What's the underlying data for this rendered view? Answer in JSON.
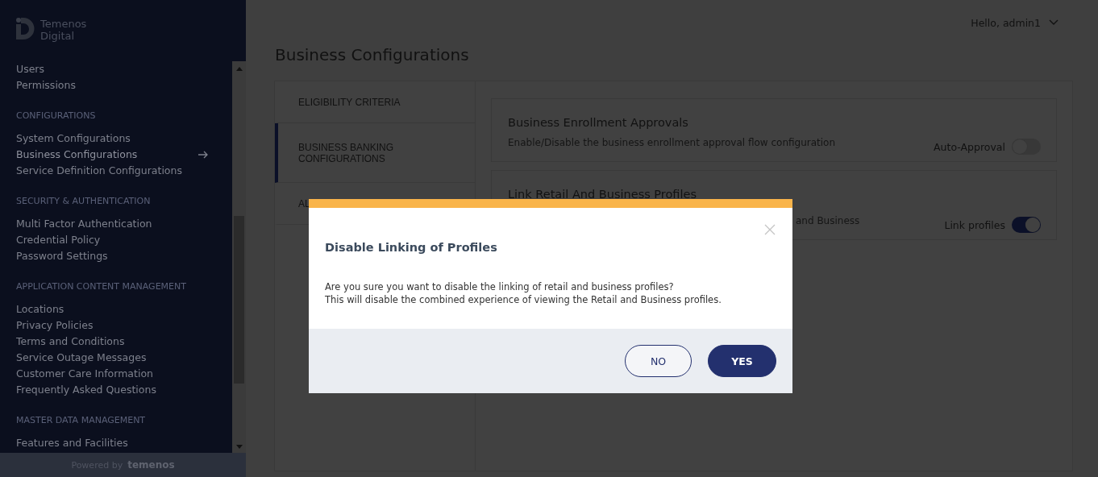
{
  "sidebar": {
    "logo": {
      "line_1": "Temenos",
      "line_2": "Digital"
    },
    "groups": [
      {
        "items": [
          {
            "label": "Users",
            "selected": false
          },
          {
            "label": "Permissions",
            "selected": false
          }
        ]
      },
      {
        "heading": "CONFIGURATIONS",
        "items": [
          {
            "label": "System Configurations",
            "selected": false
          },
          {
            "label": "Business Configurations",
            "selected": true
          },
          {
            "label": "Service Definition Configurations",
            "selected": false
          }
        ]
      },
      {
        "heading": "SECURITY & AUTHENTICATION",
        "items": [
          {
            "label": "Multi Factor Authentication",
            "selected": false
          },
          {
            "label": "Credential Policy",
            "selected": false
          },
          {
            "label": "Password Settings",
            "selected": false
          }
        ]
      },
      {
        "heading": "APPLICATION CONTENT MANAGEMENT",
        "items": [
          {
            "label": "Locations",
            "selected": false
          },
          {
            "label": "Privacy Policies",
            "selected": false
          },
          {
            "label": "Terms and Conditions",
            "selected": false
          },
          {
            "label": "Service Outage Messages",
            "selected": false
          },
          {
            "label": "Customer Care Information",
            "selected": false
          },
          {
            "label": "Frequently Asked Questions",
            "selected": false
          }
        ]
      },
      {
        "heading": "MASTER DATA MANAGEMENT",
        "items": [
          {
            "label": "Features and Facilities",
            "selected": false
          }
        ]
      }
    ],
    "footer": {
      "prefix": "Powered by",
      "brand": "temenos"
    }
  },
  "header": {
    "greeting": "Hello, admin1"
  },
  "page_title": "Business Configurations",
  "tabs": [
    {
      "label": "ELIGIBILITY CRITERIA",
      "selected": false
    },
    {
      "label": "BUSINESS BANKING CONFIGURATIONS",
      "selected": true
    },
    {
      "label": "AL",
      "selected": false
    }
  ],
  "cards": [
    {
      "title": "Business Enrollment Approvals",
      "description": "Enable/Disable the business enrollment approval flow configuration",
      "toggle_label": "Auto-Approval",
      "on": false
    },
    {
      "title": "Link Retail And Business Profiles",
      "description": "and Business",
      "toggle_label": "Link profiles",
      "on": true
    }
  ],
  "dialog": {
    "title": "Disable Linking of Profiles",
    "message_lines": [
      "Are you sure you want to disable the linking of retail and business profiles?",
      "This will disable the combined experience of viewing the Retail and Business profiles."
    ],
    "buttons": [
      {
        "label": "NO",
        "kind": "secondary"
      },
      {
        "label": "YES",
        "kind": "primary"
      }
    ]
  }
}
